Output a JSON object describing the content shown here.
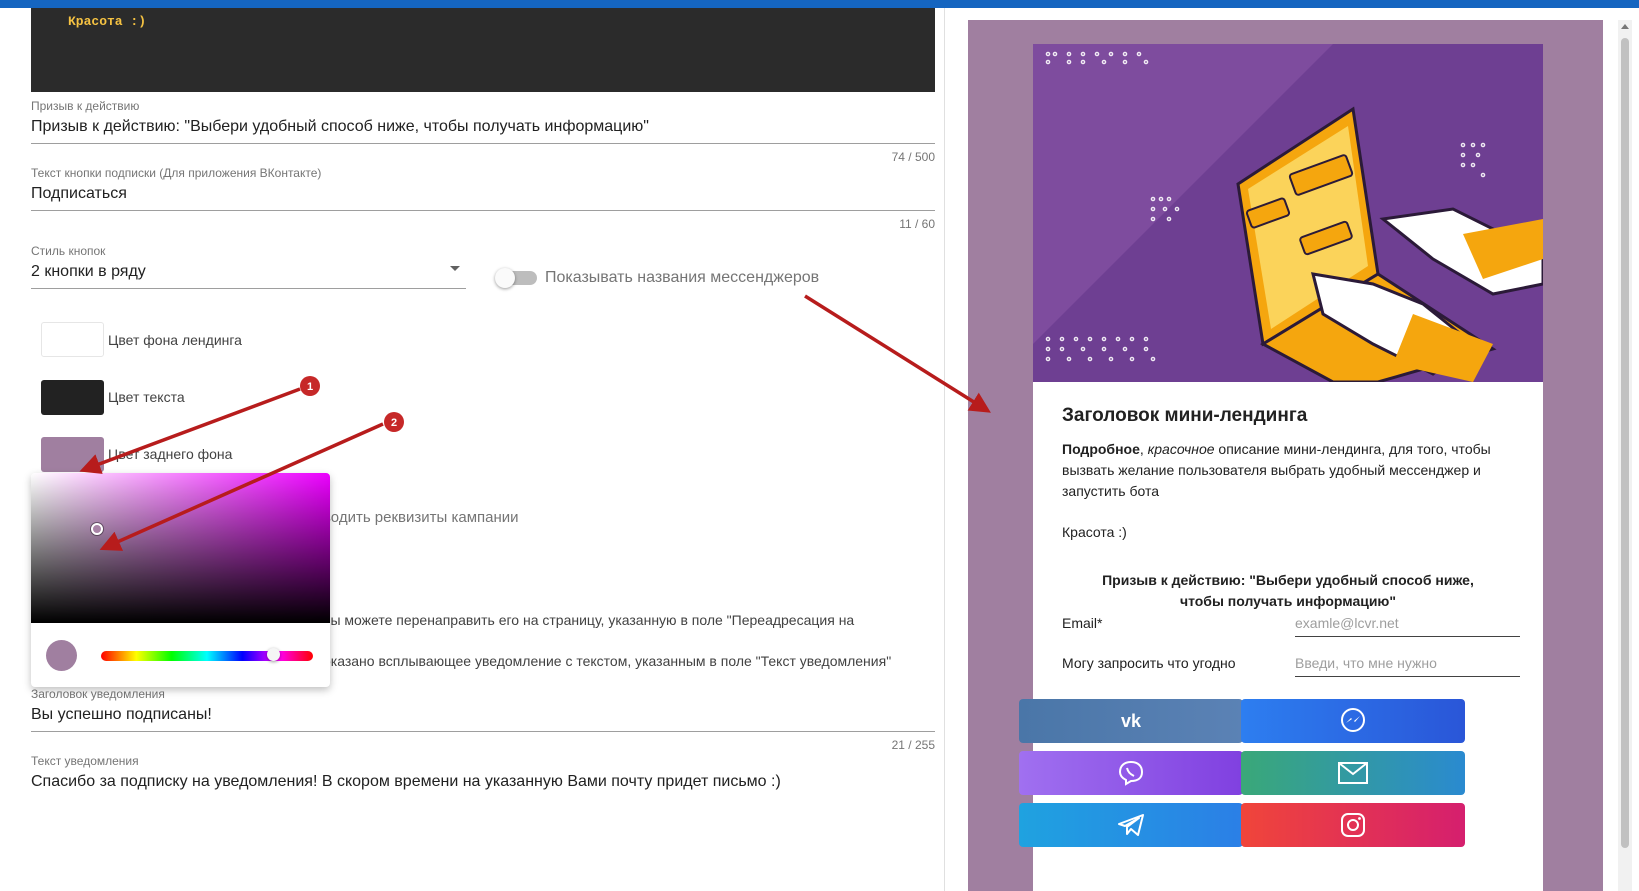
{
  "editor": {
    "code_line": "Красота :)",
    "cta_field": {
      "label": "Призыв к действию",
      "value": "Призыв к действию: \"Выбери удобный способ ниже, чтобы получать информацию\"",
      "counter": "74 / 500"
    },
    "subscribe_field": {
      "label": "Текст кнопки подписки (Для приложения ВКонтакте)",
      "value": "Подписаться",
      "counter": "11 / 60"
    },
    "button_style": {
      "label": "Стиль кнопок",
      "value": "2 кнопки в ряду"
    },
    "show_names_toggle": {
      "label": "Показывать названия мессенджеров",
      "on": false
    },
    "colors": {
      "landing_bg": {
        "label": "Цвет фона лендинга",
        "value": "#ffffff"
      },
      "text": {
        "label": "Цвет текста",
        "value": "#222222"
      },
      "back_bg": {
        "label": "Цвет заднего фона",
        "value": "#a07fa0"
      }
    },
    "hidden_fragments": {
      "campaign": "водить реквизиты кампании",
      "redirect": "вы можете перенаправить его на страницу, указанную в поле \"Переадресация на",
      "notification": "оказано всплывающее уведомление с текстом, указанным в поле \"Текст уведомления\""
    },
    "notify_title_field": {
      "label": "Заголовок уведомления",
      "value": "Вы успешно подписаны!",
      "counter": "21 / 255"
    },
    "notify_text_field": {
      "label": "Текст уведомления",
      "value": "Спасибо за подписку на уведомления! В скором времени на указанную Вами почту придет письмо :)"
    }
  },
  "annotations": {
    "marker1": "1",
    "marker2": "2"
  },
  "preview": {
    "title": "Заголовок мини-лендинга",
    "desc_bold": "Подробное",
    "desc_sep": ", ",
    "desc_italic": "красочное",
    "desc_rest": " описание мини-лендинга, для того, чтобы вызвать желание пользователя выбрать удобный мессенджер и запустить бота",
    "extra": "Красота :)",
    "cta": "Призыв к действию: \"Выбери удобный способ ниже, чтобы получать информацию\"",
    "form": [
      {
        "label": "Email*",
        "placeholder": "examle@lcvr.net"
      },
      {
        "label": "Могу запросить что угодно",
        "placeholder": "Введи, что мне нужно"
      }
    ],
    "buttons": [
      {
        "name": "vk-icon",
        "color": "#5181b8"
      },
      {
        "name": "messenger-icon",
        "color": "#1e64e8"
      },
      {
        "name": "viber-icon",
        "color": "#8e4fe0"
      },
      {
        "name": "email-icon",
        "color": "#29a08a"
      },
      {
        "name": "telegram-icon",
        "color": "#2196f3"
      },
      {
        "name": "instagram-icon",
        "color": "#e1306c"
      }
    ]
  }
}
